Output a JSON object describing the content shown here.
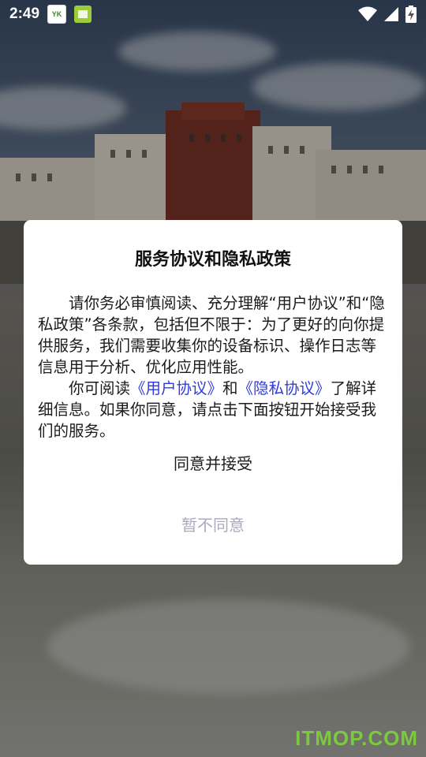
{
  "status_bar": {
    "time": "2:49",
    "app_badge_1": "YK",
    "icons": [
      "wifi-icon",
      "signal-icon",
      "battery-charging-icon"
    ]
  },
  "dialog": {
    "title": "服务协议和隐私政策",
    "paragraph1": "请你务必审慎阅读、充分理解“用户协议”和“隐私政策”各条款，包括但不限于：为了更好的向你提供服务，我们需要收集你的设备标识、操作日志等信息用于分析、优化应用性能。",
    "paragraph2_prefix": "你可阅读",
    "user_agreement_link": "《用户协议》",
    "paragraph2_and": "和",
    "privacy_policy_link": "《隐私协议》",
    "paragraph2_suffix": "了解详细信息。如果你同意，请点击下面按钮开始接受我们的服务。",
    "agree_button": "同意并接受",
    "decline_button": "暂不同意"
  },
  "watermark": "ITMOP.COM",
  "colors": {
    "link": "#2e3bdc",
    "decline_text": "#a9abbd",
    "watermark": "#7fd33a"
  }
}
